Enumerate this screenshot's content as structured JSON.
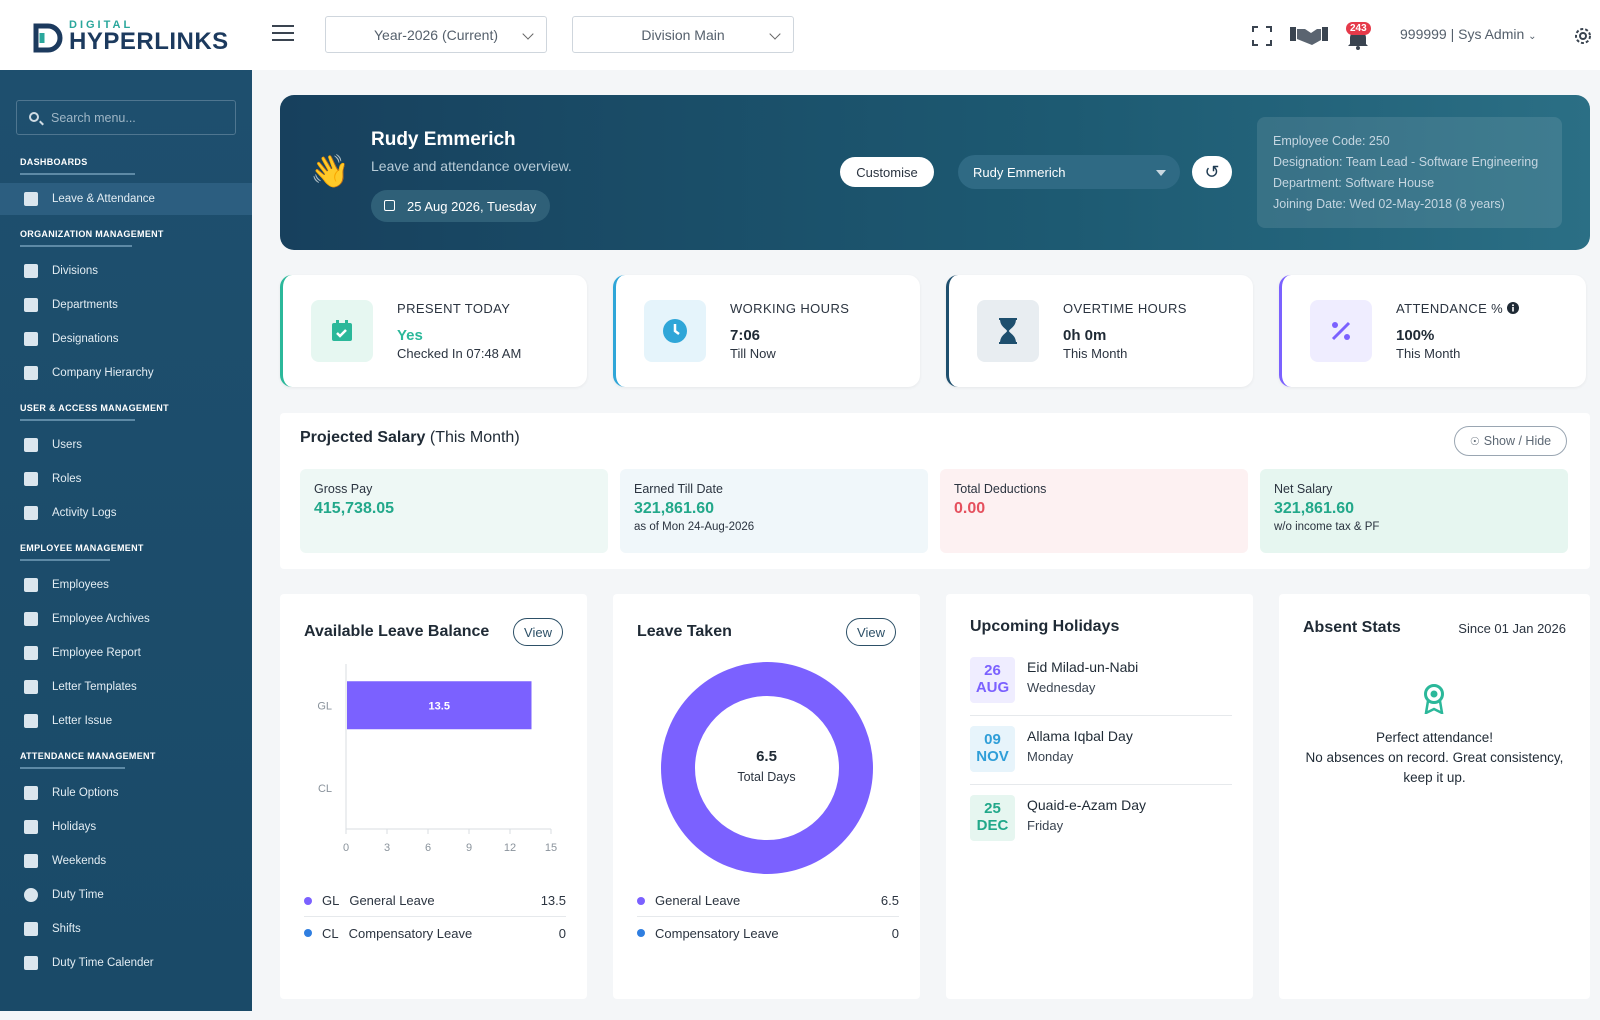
{
  "brand": {
    "top": "DIGITAL",
    "name": "HYPERLINKS"
  },
  "topbar": {
    "year": "Year-2026 (Current)",
    "division": "Division Main",
    "notifications": "243",
    "user": "999999 | Sys Admin"
  },
  "sidebar": {
    "search_placeholder": "Search menu...",
    "sections": [
      {
        "title": "DASHBOARDS",
        "items": [
          "Leave & Attendance"
        ]
      },
      {
        "title": "ORGANIZATION MANAGEMENT",
        "items": [
          "Divisions",
          "Departments",
          "Designations",
          "Company Hierarchy"
        ]
      },
      {
        "title": "USER & ACCESS MANAGEMENT",
        "items": [
          "Users",
          "Roles",
          "Activity Logs"
        ]
      },
      {
        "title": "EMPLOYEE MANAGEMENT",
        "items": [
          "Employees",
          "Employee Archives",
          "Employee Report",
          "Letter Templates",
          "Letter Issue"
        ]
      },
      {
        "title": "ATTENDANCE MANAGEMENT",
        "items": [
          "Rule Options",
          "Holidays",
          "Weekends",
          "Duty Time",
          "Shifts",
          "Duty Time Calender"
        ]
      }
    ]
  },
  "hero": {
    "name": "Rudy Emmerich",
    "subtitle": "Leave and attendance overview.",
    "date": "25 Aug 2026, Tuesday",
    "customise": "Customise",
    "employee_select": "Rudy Emmerich",
    "info": [
      "Employee Code: 250",
      "Designation: Team Lead - Software Engineering",
      "Department: Software House",
      "Joining Date: Wed 02-May-2018 (8 years)"
    ]
  },
  "stats": [
    {
      "title": "PRESENT TODAY",
      "value": "Yes",
      "note": "Checked In 07:48 AM",
      "accent": "#2bb89a",
      "bg": "#e6f7f1"
    },
    {
      "title": "WORKING HOURS",
      "value": "7:06",
      "note": "Till Now",
      "accent": "#2fa6d8",
      "bg": "#e5f4fb"
    },
    {
      "title": "OVERTIME HOURS",
      "value": "0h 0m",
      "note": "This Month",
      "accent": "#1e4f6e",
      "bg": "#e8edf1"
    },
    {
      "title": "ATTENDANCE %",
      "value": "100%",
      "note": "This Month",
      "accent": "#7b61ff",
      "bg": "#efedff"
    }
  ],
  "salary": {
    "title": "Projected Salary",
    "period": "(This Month)",
    "toggle": "Show / Hide",
    "boxes": [
      {
        "label": "Gross Pay",
        "value": "415,738.05",
        "note": ""
      },
      {
        "label": "Earned Till Date",
        "value": "321,861.60",
        "note": "as of Mon 24-Aug-2026"
      },
      {
        "label": "Total Deductions",
        "value": "0.00",
        "note": ""
      },
      {
        "label": "Net Salary",
        "value": "321,861.60",
        "note": "w/o income tax & PF"
      }
    ]
  },
  "leave_balance": {
    "title": "Available Leave Balance",
    "view": "View",
    "legend": [
      {
        "code": "GL",
        "name": "General Leave",
        "value": "13.5",
        "color": "#7b61ff"
      },
      {
        "code": "CL",
        "name": "Compensatory Leave",
        "value": "0",
        "color": "#2f7ee0"
      }
    ]
  },
  "leave_taken": {
    "title": "Leave Taken",
    "view": "View",
    "total": "6.5",
    "total_label": "Total Days",
    "legend": [
      {
        "name": "General Leave",
        "value": "6.5",
        "color": "#7b61ff"
      },
      {
        "name": "Compensatory Leave",
        "value": "0",
        "color": "#2f7ee0"
      }
    ]
  },
  "holidays": {
    "title": "Upcoming Holidays",
    "items": [
      {
        "day": "26",
        "mon": "AUG",
        "name": "Eid Milad-un-Nabi",
        "weekday": "Wednesday",
        "color": "#7b61ff",
        "bg": "#efedff"
      },
      {
        "day": "09",
        "mon": "NOV",
        "name": "Allama Iqbal Day",
        "weekday": "Monday",
        "color": "#2f9ed8",
        "bg": "#e7f4fb"
      },
      {
        "day": "25",
        "mon": "DEC",
        "name": "Quaid-e-Azam Day",
        "weekday": "Friday",
        "color": "#22a88a",
        "bg": "#e6f6f0"
      }
    ]
  },
  "absent": {
    "title": "Absent Stats",
    "since": "Since 01 Jan 2026",
    "line1": "Perfect attendance!",
    "line2": "No absences on record. Great consistency,",
    "line3": "keep it up."
  },
  "chart_data": [
    {
      "type": "bar",
      "title": "Available Leave Balance",
      "categories": [
        "GL",
        "CL"
      ],
      "values": [
        13.5,
        0
      ],
      "xlim": [
        0,
        15
      ],
      "xticks": [
        "0",
        "3",
        "6",
        "9",
        "12",
        "15"
      ],
      "orientation": "horizontal"
    },
    {
      "type": "pie",
      "title": "Leave Taken",
      "categories": [
        "General Leave",
        "Compensatory Leave"
      ],
      "values": [
        6.5,
        0
      ],
      "center_value": "6.5",
      "center_label": "Total Days"
    }
  ]
}
